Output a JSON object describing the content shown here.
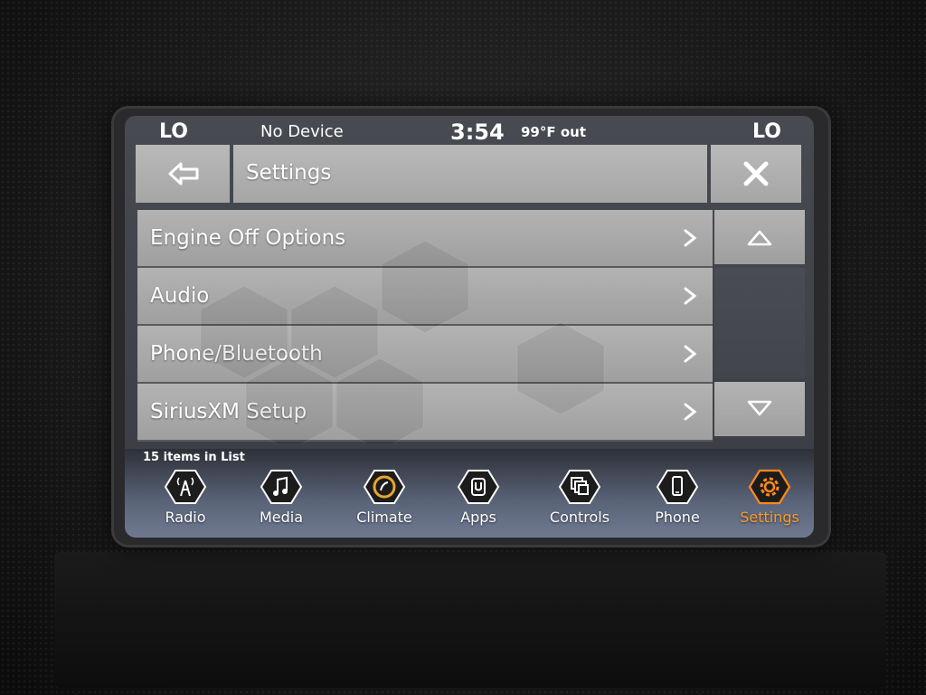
{
  "status_bar": {
    "left_climate": "LO",
    "device": "No Device",
    "time": "3:54",
    "outside_temp": "99°F out",
    "right_climate": "LO"
  },
  "header": {
    "title": "Settings",
    "back_icon": "back-arrow-icon",
    "close_icon": "close-icon"
  },
  "settings_list": {
    "items": [
      {
        "label": "Engine Off Options"
      },
      {
        "label": "Audio"
      },
      {
        "label": "Phone/Bluetooth"
      },
      {
        "label": "SiriusXM Setup"
      }
    ],
    "count_text": "15 items in List"
  },
  "scroll": {
    "up_icon": "triangle-up-icon",
    "down_icon": "triangle-down-icon"
  },
  "nav": {
    "active": "Settings",
    "accent_color": "#ff8a1c",
    "items": [
      {
        "label": "Radio",
        "icon": "radio-tower-icon"
      },
      {
        "label": "Media",
        "icon": "music-note-icon"
      },
      {
        "label": "Climate",
        "icon": "climate-icon"
      },
      {
        "label": "Apps",
        "icon": "apps-icon"
      },
      {
        "label": "Controls",
        "icon": "controls-icon"
      },
      {
        "label": "Phone",
        "icon": "phone-icon"
      },
      {
        "label": "Settings",
        "icon": "gear-icon"
      }
    ]
  }
}
